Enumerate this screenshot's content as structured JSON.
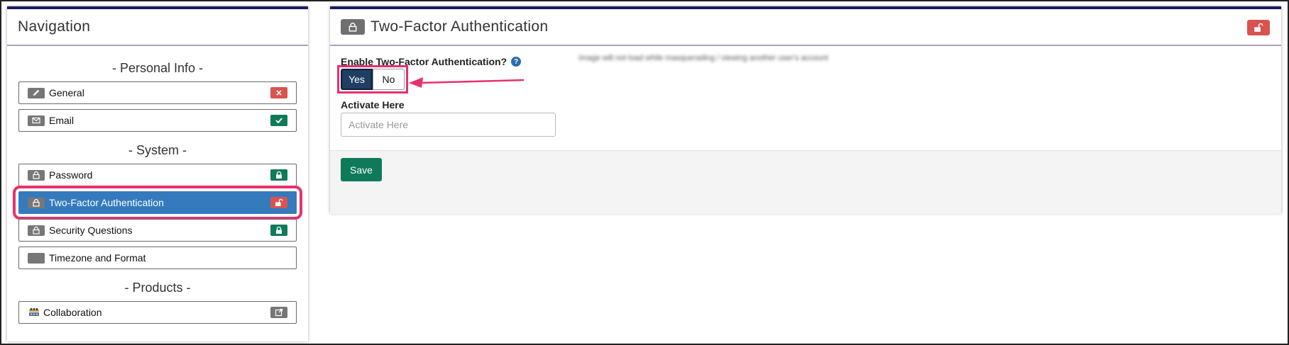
{
  "navigation": {
    "title": "Navigation",
    "sections": {
      "personal": "- Personal Info -",
      "system": "- System -",
      "products": "- Products -"
    },
    "items": {
      "general": "General",
      "email": "Email",
      "password": "Password",
      "two_factor": "Two-Factor Authentication",
      "security_questions": "Security Questions",
      "timezone": "Timezone and Format",
      "collaboration": "Collaboration"
    }
  },
  "main": {
    "title": "Two-Factor Authentication",
    "enable_label": "Enable Two-Factor Authentication?",
    "help_glyph": "?",
    "note": "Image will not load while masquerading / viewing another user's account",
    "toggle": {
      "yes": "Yes",
      "no": "No",
      "selected": "Yes"
    },
    "activate_label": "Activate Here",
    "activate_placeholder": "Activate Here",
    "save_label": "Save"
  },
  "colors": {
    "active_nav": "#357abd",
    "highlight": "#e8306d",
    "success": "#0f7a5a",
    "danger": "#d9534f",
    "panel_top": "#1e1b5e"
  }
}
